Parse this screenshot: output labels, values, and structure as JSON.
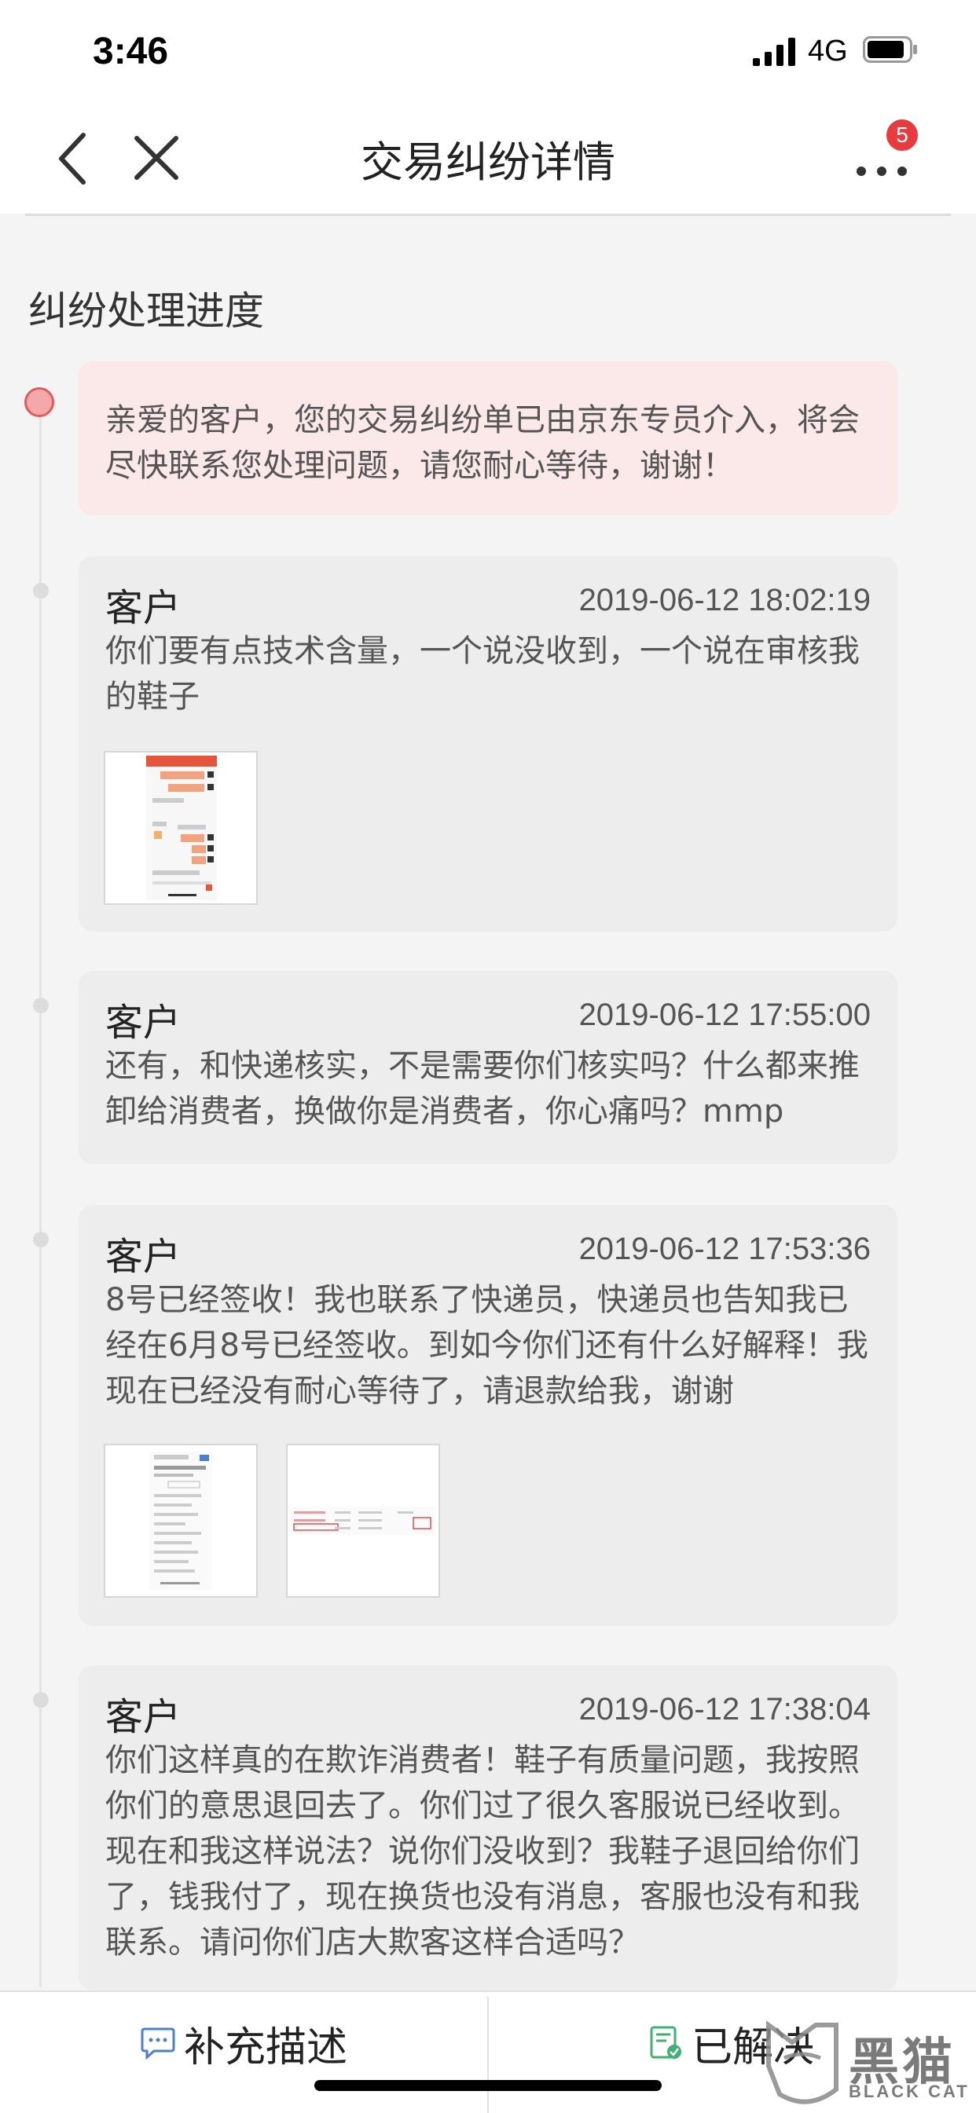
{
  "status_bar": {
    "time": "3:46",
    "network": "4G"
  },
  "nav": {
    "title": "交易纠纷详情",
    "badge_count": "5"
  },
  "section_title": "纠纷处理进度",
  "notice": "亲爱的客户，您的交易纠纷单已由京东专员介入，将会尽快联系您处理问题，请您耐心等待，谢谢！",
  "messages": [
    {
      "author": "客户",
      "timestamp": "2019-06-12 18:02:19",
      "text": "你们要有点技术含量，一个说没收到，一个说在审核我的鞋子",
      "images": 1
    },
    {
      "author": "客户",
      "timestamp": "2019-06-12 17:55:00",
      "text": "还有，和快递核实，不是需要你们核实吗？什么都来推卸给消费者，换做你是消费者，你心痛吗？mmp",
      "images": 0
    },
    {
      "author": "客户",
      "timestamp": "2019-06-12 17:53:36",
      "text": "8号已经签收！我也联系了快递员，快递员也告知我已经在6月8号已经签收。到如今你们还有什么好解释！我现在已经没有耐心等待了，请退款给我，谢谢",
      "images": 2
    },
    {
      "author": "客户",
      "timestamp": "2019-06-12 17:38:04",
      "text": "你们这样真的在欺诈消费者！鞋子有质量问题，我按照你们的意思退回去了。你们过了很久客服说已经收到。现在和我这样说法？说你们没收到？我鞋子退回给你们了，钱我付了，现在换货也没有消息，客服也没有和我联系。请问你们店大欺客这样合适吗？",
      "images": 0
    }
  ],
  "bottom_bar": {
    "supplement_label": "补充描述",
    "resolved_label": "已解决"
  },
  "watermark": {
    "main": "黑猫",
    "sub": "BLACK CAT"
  },
  "colors": {
    "accent_red": "#e5585b",
    "notice_bg": "#fbe8e8",
    "card_bg": "#ededed",
    "icon_blue": "#4a7fd6",
    "icon_green": "#3cb371"
  }
}
